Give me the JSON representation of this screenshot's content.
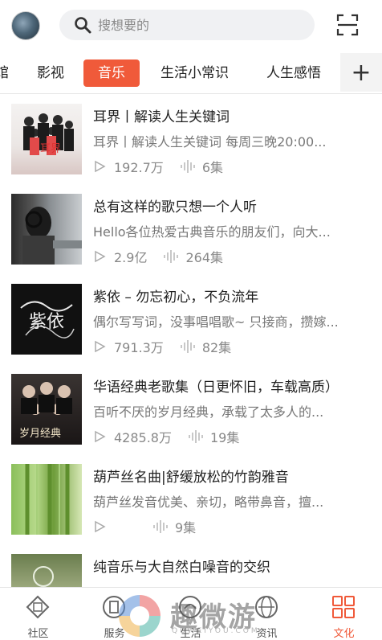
{
  "header": {
    "search_placeholder": "搜想要的",
    "avatar_icon": "avatar-icon",
    "search_icon": "search-icon",
    "scan_icon": "scan-icon"
  },
  "tabs": [
    {
      "label": "馆"
    },
    {
      "label": "影视"
    },
    {
      "label": "音乐",
      "active": true
    },
    {
      "label": "生活小常识"
    },
    {
      "label": "人生感悟"
    }
  ],
  "tab_add_label": "+",
  "accent_color": "#f05a3a",
  "items": [
    {
      "title": "耳界丨解读人生关键词",
      "desc": "耳界丨解读人生关键词 每周三晚20:00...",
      "plays": "192.7万",
      "episodes": "6集",
      "thumb_text": "耳界"
    },
    {
      "title": "总有这样的歌只想一个人听",
      "desc": "Hello各位热爱古典音乐的朋友们，向大...",
      "plays": "2.9亿",
      "episodes": "264集",
      "thumb_text": ""
    },
    {
      "title": "紫依 – 勿忘初心，不负流年",
      "desc": "偶尔写写词，没事唱唱歌~ 只接商，攒嫁...",
      "plays": "791.3万",
      "episodes": "82集",
      "thumb_text": "紫依"
    },
    {
      "title": "华语经典老歌集（日更怀旧，车载高质）",
      "desc": "百听不厌的岁月经典，承载了太多人的...",
      "plays": "4285.8万",
      "episodes": "19集",
      "thumb_text": "岁月经典"
    },
    {
      "title": "葫芦丝名曲|舒缓放松的竹韵雅音",
      "desc": "葫芦丝发音优美、亲切，略带鼻音，擅...",
      "plays": "",
      "episodes": "9集",
      "thumb_text": ""
    },
    {
      "title": "纯音乐与大自然白噪音的交织",
      "desc": "",
      "plays": "",
      "episodes": "",
      "thumb_text": ""
    }
  ],
  "bottom_nav": [
    {
      "label": "社区",
      "icon": "community-icon"
    },
    {
      "label": "服务",
      "icon": "service-icon"
    },
    {
      "label": "生活",
      "icon": "life-icon"
    },
    {
      "label": "资讯",
      "icon": "news-icon"
    },
    {
      "label": "文化",
      "icon": "culture-grid-icon",
      "active": true
    }
  ],
  "watermark": {
    "text": "趣微游",
    "sub": "QUWEIYOU.COM"
  }
}
